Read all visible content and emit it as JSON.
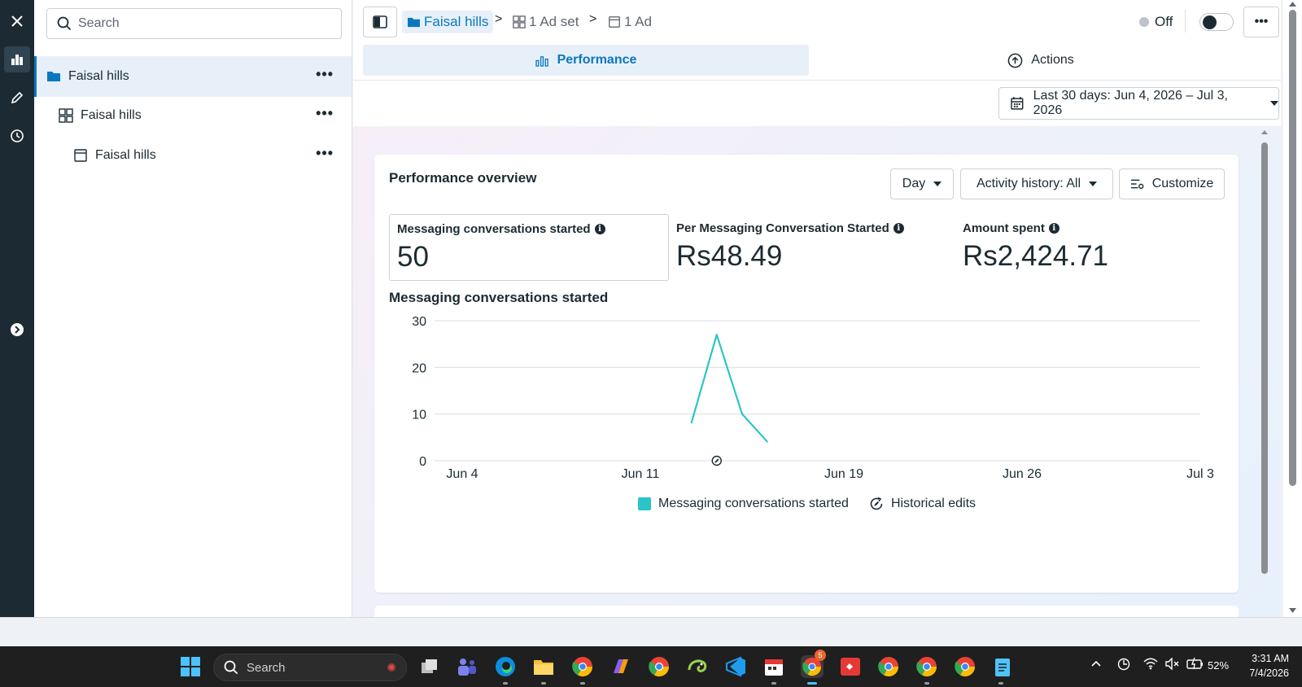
{
  "sidebar": {
    "search_placeholder": "Search",
    "items": [
      {
        "label": "Faisal hills",
        "icon": "folder-icon",
        "level": "campaign"
      },
      {
        "label": "Faisal hills",
        "icon": "adset-grid-icon",
        "level": "ad set"
      },
      {
        "label": "Faisal hills",
        "icon": "ad-icon",
        "level": "ad"
      }
    ],
    "more_label": "•••"
  },
  "breadcrumb": {
    "campaign": "Faisal hills",
    "adset": "1 Ad set",
    "ad": "1 Ad"
  },
  "status": {
    "label": "Off",
    "on": false
  },
  "more_label": "•••",
  "tabs": [
    {
      "label": "Performance",
      "active": true
    },
    {
      "label": "Actions",
      "active": false
    }
  ],
  "date_range": "Last 30 days: Jun 4, 2026 – Jul 3, 2026",
  "overview": {
    "title": "Performance overview",
    "granularity": "Day",
    "activity_history": "Activity history: All",
    "customize": "Customize",
    "metrics": [
      {
        "label": "Messaging conversations started",
        "value": "50",
        "selected": true
      },
      {
        "label": "Per Messaging Conversation Started",
        "value": "Rs48.49",
        "selected": false
      },
      {
        "label": "Amount spent",
        "value": "Rs2,424.71",
        "selected": false
      }
    ]
  },
  "chart_data": {
    "type": "line",
    "title": "Messaging conversations started",
    "x_ticks": [
      "Jun 4",
      "Jun 11",
      "Jun 19",
      "Jun 26",
      "Jul 3"
    ],
    "y_ticks": [
      0,
      10,
      20,
      30
    ],
    "ylim": [
      0,
      30
    ],
    "series": [
      {
        "name": "Messaging conversations started",
        "color": "#2bc4c8",
        "points": [
          {
            "x": "Jun 13",
            "y": 8
          },
          {
            "x": "Jun 14",
            "y": 27
          },
          {
            "x": "Jun 15",
            "y": 10
          },
          {
            "x": "Jun 16",
            "y": 4
          }
        ]
      }
    ],
    "historical_edit_marker": "Jun 14",
    "legend": [
      "Messaging conversations started",
      "Historical edits"
    ],
    "legend_position": "bottom",
    "grid": true
  },
  "taskbar": {
    "search_label": "Search",
    "battery": "52%",
    "time": "3:31 AM",
    "date": "7/4/2026",
    "badge": "5"
  },
  "colors": {
    "accent": "#0a78be",
    "series": "#2bc4c8",
    "rail": "#1c2b33"
  }
}
